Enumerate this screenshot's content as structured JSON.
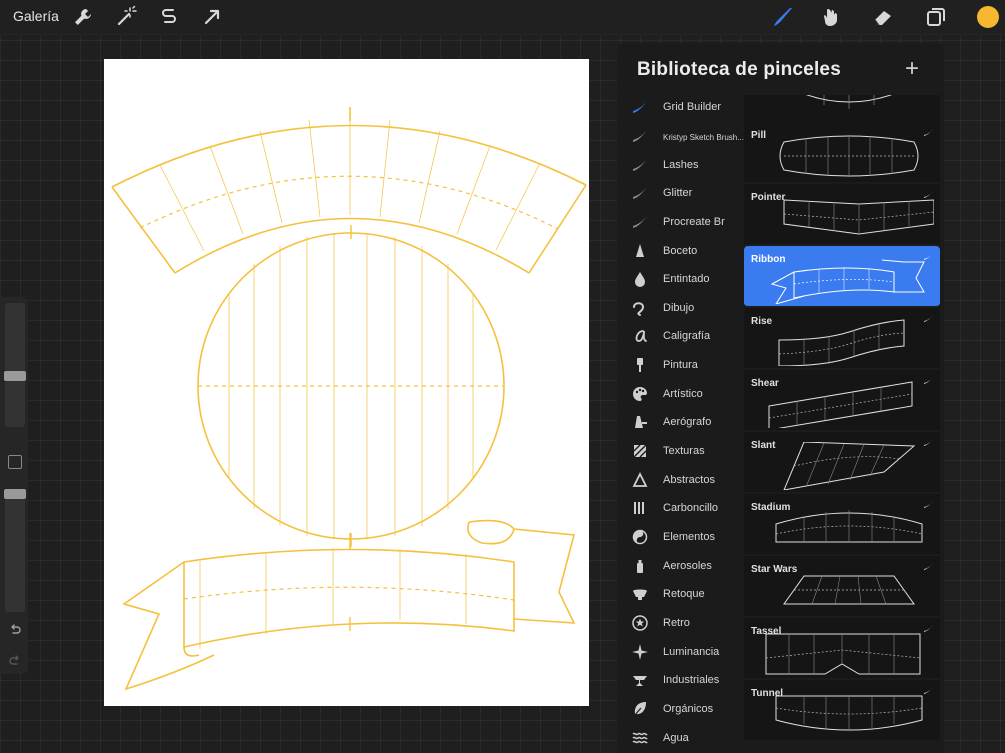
{
  "topbar": {
    "gallery_label": "Galería",
    "left_tools": [
      "wrench-icon",
      "magic-wand-icon",
      "selection-icon",
      "transform-arrow-icon"
    ],
    "right_tools": [
      "brush-icon",
      "smudge-icon",
      "eraser-icon",
      "layers-icon"
    ],
    "current_color": "#f5b82e"
  },
  "panel": {
    "title": "Biblioteca de pinceles",
    "add_label": "+",
    "categories": [
      {
        "label": "Grid Builder",
        "icon": "brush-stroke-icon",
        "selected": true
      },
      {
        "label": "Kristyp Sketch Brush...",
        "icon": "brush-stroke-icon"
      },
      {
        "label": "Lashes",
        "icon": "brush-stroke-icon"
      },
      {
        "label": "Glitter",
        "icon": "brush-stroke-icon"
      },
      {
        "label": "Procreate Br",
        "icon": "brush-stroke-icon"
      },
      {
        "label": "Boceto",
        "icon": "pencil-tip-icon"
      },
      {
        "label": "Entintado",
        "icon": "ink-drop-icon"
      },
      {
        "label": "Dibujo",
        "icon": "squiggle-icon"
      },
      {
        "label": "Caligrafía",
        "icon": "calligraphy-icon"
      },
      {
        "label": "Pintura",
        "icon": "paint-brush-icon"
      },
      {
        "label": "Artístico",
        "icon": "palette-icon"
      },
      {
        "label": "Aerógrafo",
        "icon": "airbrush-icon"
      },
      {
        "label": "Texturas",
        "icon": "texture-icon"
      },
      {
        "label": "Abstractos",
        "icon": "triangle-icon"
      },
      {
        "label": "Carboncillo",
        "icon": "charcoal-icon"
      },
      {
        "label": "Elementos",
        "icon": "yin-yang-icon"
      },
      {
        "label": "Aerosoles",
        "icon": "spray-can-icon"
      },
      {
        "label": "Retoque",
        "icon": "retouch-icon"
      },
      {
        "label": "Retro",
        "icon": "star-circle-icon"
      },
      {
        "label": "Luminancia",
        "icon": "sparkle-icon"
      },
      {
        "label": "Industriales",
        "icon": "anvil-icon"
      },
      {
        "label": "Orgánicos",
        "icon": "leaf-icon"
      },
      {
        "label": "Agua",
        "icon": "waves-icon"
      }
    ],
    "brushes": [
      {
        "name": "",
        "preview": "arc-bottom"
      },
      {
        "name": "Pill",
        "preview": "pill"
      },
      {
        "name": "Pointer",
        "preview": "pointer"
      },
      {
        "name": "Ribbon",
        "preview": "ribbon",
        "selected": true
      },
      {
        "name": "Rise",
        "preview": "rise"
      },
      {
        "name": "Shear",
        "preview": "shear"
      },
      {
        "name": "Slant",
        "preview": "slant"
      },
      {
        "name": "Stadium",
        "preview": "stadium"
      },
      {
        "name": "Star Wars",
        "preview": "starwars"
      },
      {
        "name": "Tassel",
        "preview": "tassel"
      },
      {
        "name": "Tunnel",
        "preview": "tunnel"
      }
    ]
  },
  "colors": {
    "accent": "#3a7cf0",
    "guide": "#f5c13d"
  }
}
